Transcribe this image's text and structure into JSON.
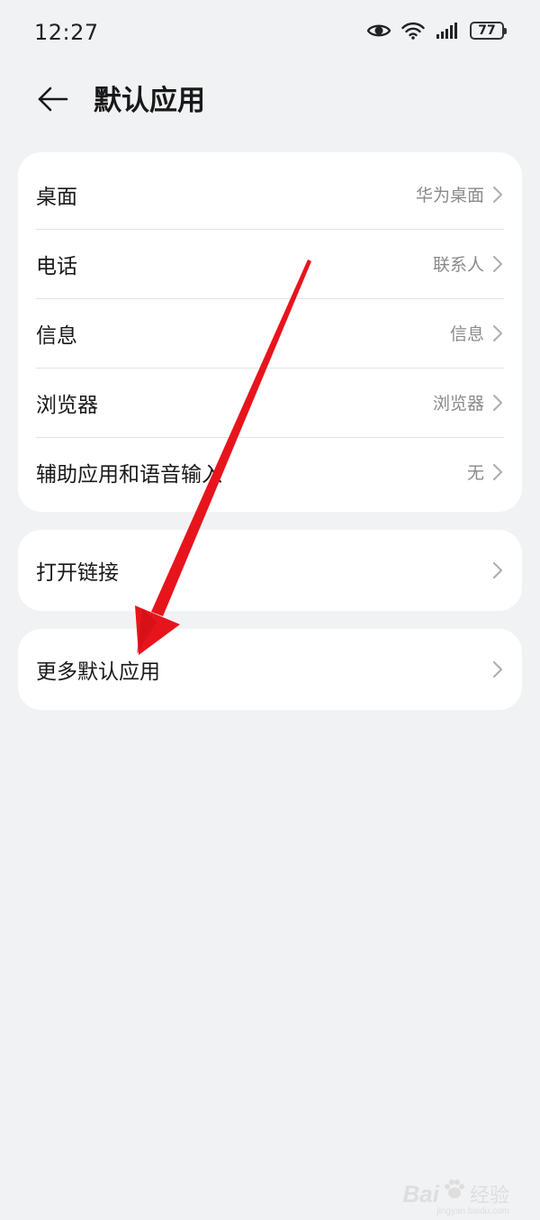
{
  "status_bar": {
    "time": "12:27",
    "battery": "77",
    "icons": [
      "eye-icon",
      "wifi-icon",
      "signal-icon",
      "battery-icon"
    ]
  },
  "header": {
    "back_icon": "arrow-left-icon",
    "title": "默认应用"
  },
  "group1": {
    "items": [
      {
        "label": "桌面",
        "value": "华为桌面"
      },
      {
        "label": "电话",
        "value": "联系人"
      },
      {
        "label": "信息",
        "value": "信息"
      },
      {
        "label": "浏览器",
        "value": "浏览器"
      },
      {
        "label": "辅助应用和语音输入",
        "value": "无"
      }
    ]
  },
  "group2": {
    "label": "打开链接"
  },
  "group3": {
    "label": "更多默认应用"
  },
  "watermark": {
    "logo": "Bai",
    "cn": "经验",
    "url": "jingyan.baidu.com"
  },
  "colors": {
    "background": "#f1f2f4",
    "card": "#ffffff",
    "annotation_arrow": "#e8141c",
    "secondary_text": "#8a8a8a"
  }
}
